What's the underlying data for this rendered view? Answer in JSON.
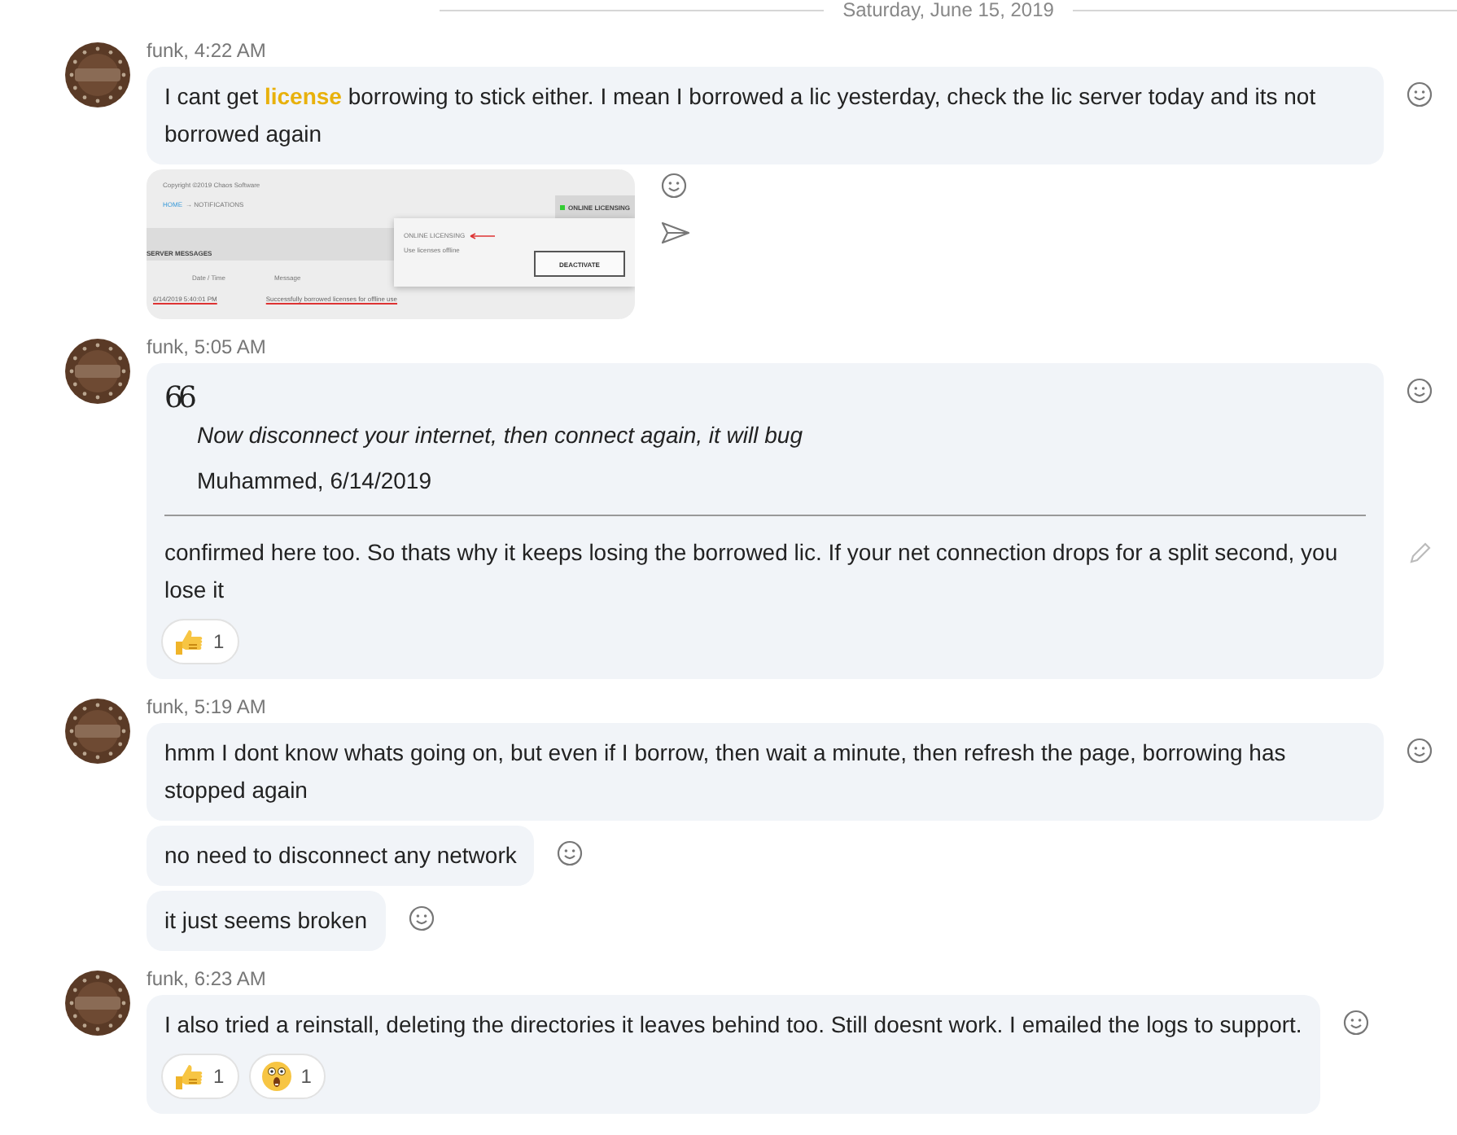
{
  "date_divider": "Saturday, June 15, 2019",
  "messages": [
    {
      "header": "funk, 4:22 AM",
      "items": [
        {
          "kind": "text",
          "text": "I cant get **license** borrowing to stick either. I mean I borrowed a lic yesterday, check the lic server today and its not borrowed again"
        },
        {
          "kind": "image",
          "screenshot": {
            "copyright": "Copyright ©2019 Chaos Software",
            "nav_home": "HOME",
            "nav_current": "→ NOTIFICATIONS",
            "status_button": "ONLINE LICENSING",
            "section": "SERVER MESSAGES",
            "columns": [
              "Date / Time",
              "Message"
            ],
            "row": [
              "6/14/2019 5:40:01 PM",
              "Successfully borrowed licenses for offline use"
            ],
            "popup": {
              "title": "ONLINE LICENSING",
              "subtitle": "Use licenses offline",
              "button": "DEACTIVATE"
            }
          }
        }
      ]
    },
    {
      "header": "funk, 5:05 AM",
      "items": [
        {
          "kind": "quote",
          "quote_mark": "66",
          "quote": {
            "text": "Now disconnect your internet, then connect again, it will bug",
            "author": "Muhammed, 6/14/2019"
          },
          "text": "confirmed here too. So thats why it keeps losing the borrowed lic. If your net connection drops for a split second, you lose it",
          "editable": true,
          "reactions": [
            {
              "kind": "like",
              "count": "1"
            }
          ]
        }
      ]
    },
    {
      "header": "funk, 5:19 AM",
      "items": [
        {
          "kind": "text",
          "text": "hmm I dont know whats going on, but even if I borrow, then wait a minute, then refresh the page, borrowing has stopped again"
        },
        {
          "kind": "text",
          "text": "no need to disconnect any network"
        },
        {
          "kind": "text",
          "text": "it just seems broken"
        }
      ]
    },
    {
      "header": "funk, 6:23 AM",
      "items": [
        {
          "kind": "text",
          "text": "I also tried a reinstall, deleting the directories it leaves behind too. Still doesnt work. I emailed the logs to support.",
          "reactions": [
            {
              "kind": "like",
              "count": "1"
            },
            {
              "kind": "surprised",
              "count": "1"
            }
          ]
        }
      ]
    }
  ]
}
